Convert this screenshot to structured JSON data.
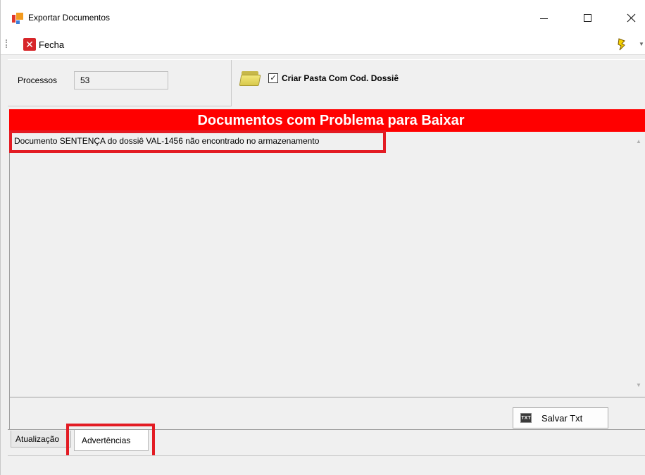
{
  "window": {
    "title": "Exportar Documentos",
    "controls": {
      "minimize": "—",
      "maximize": "☐",
      "close": "✕"
    }
  },
  "toolbar": {
    "fecha_label": "Fecha",
    "fecha_icon": "close-x-icon",
    "bolt_icon": "lightning-icon"
  },
  "processos": {
    "label": "Processos",
    "value": "53"
  },
  "pasta": {
    "checkbox_label": "Criar Pasta Com Cod. Dossiê",
    "checked": true,
    "check_glyph": "✓",
    "icon": "folder-icon"
  },
  "problems": {
    "header": "Documentos com Problema para Baixar",
    "header_color": "#ff0000",
    "lines": [
      "Documento SENTENÇA do dossiê VAL-1456 não encontrado no armazenamento"
    ]
  },
  "actions": {
    "salvar_label": "Salvar Txt",
    "salvar_icon_text": "TXT"
  },
  "tabs": [
    {
      "label": "Atualização",
      "active": false
    },
    {
      "label": "Advertências",
      "active": true
    }
  ],
  "accent_colors": {
    "highlight": "#e31b23"
  }
}
